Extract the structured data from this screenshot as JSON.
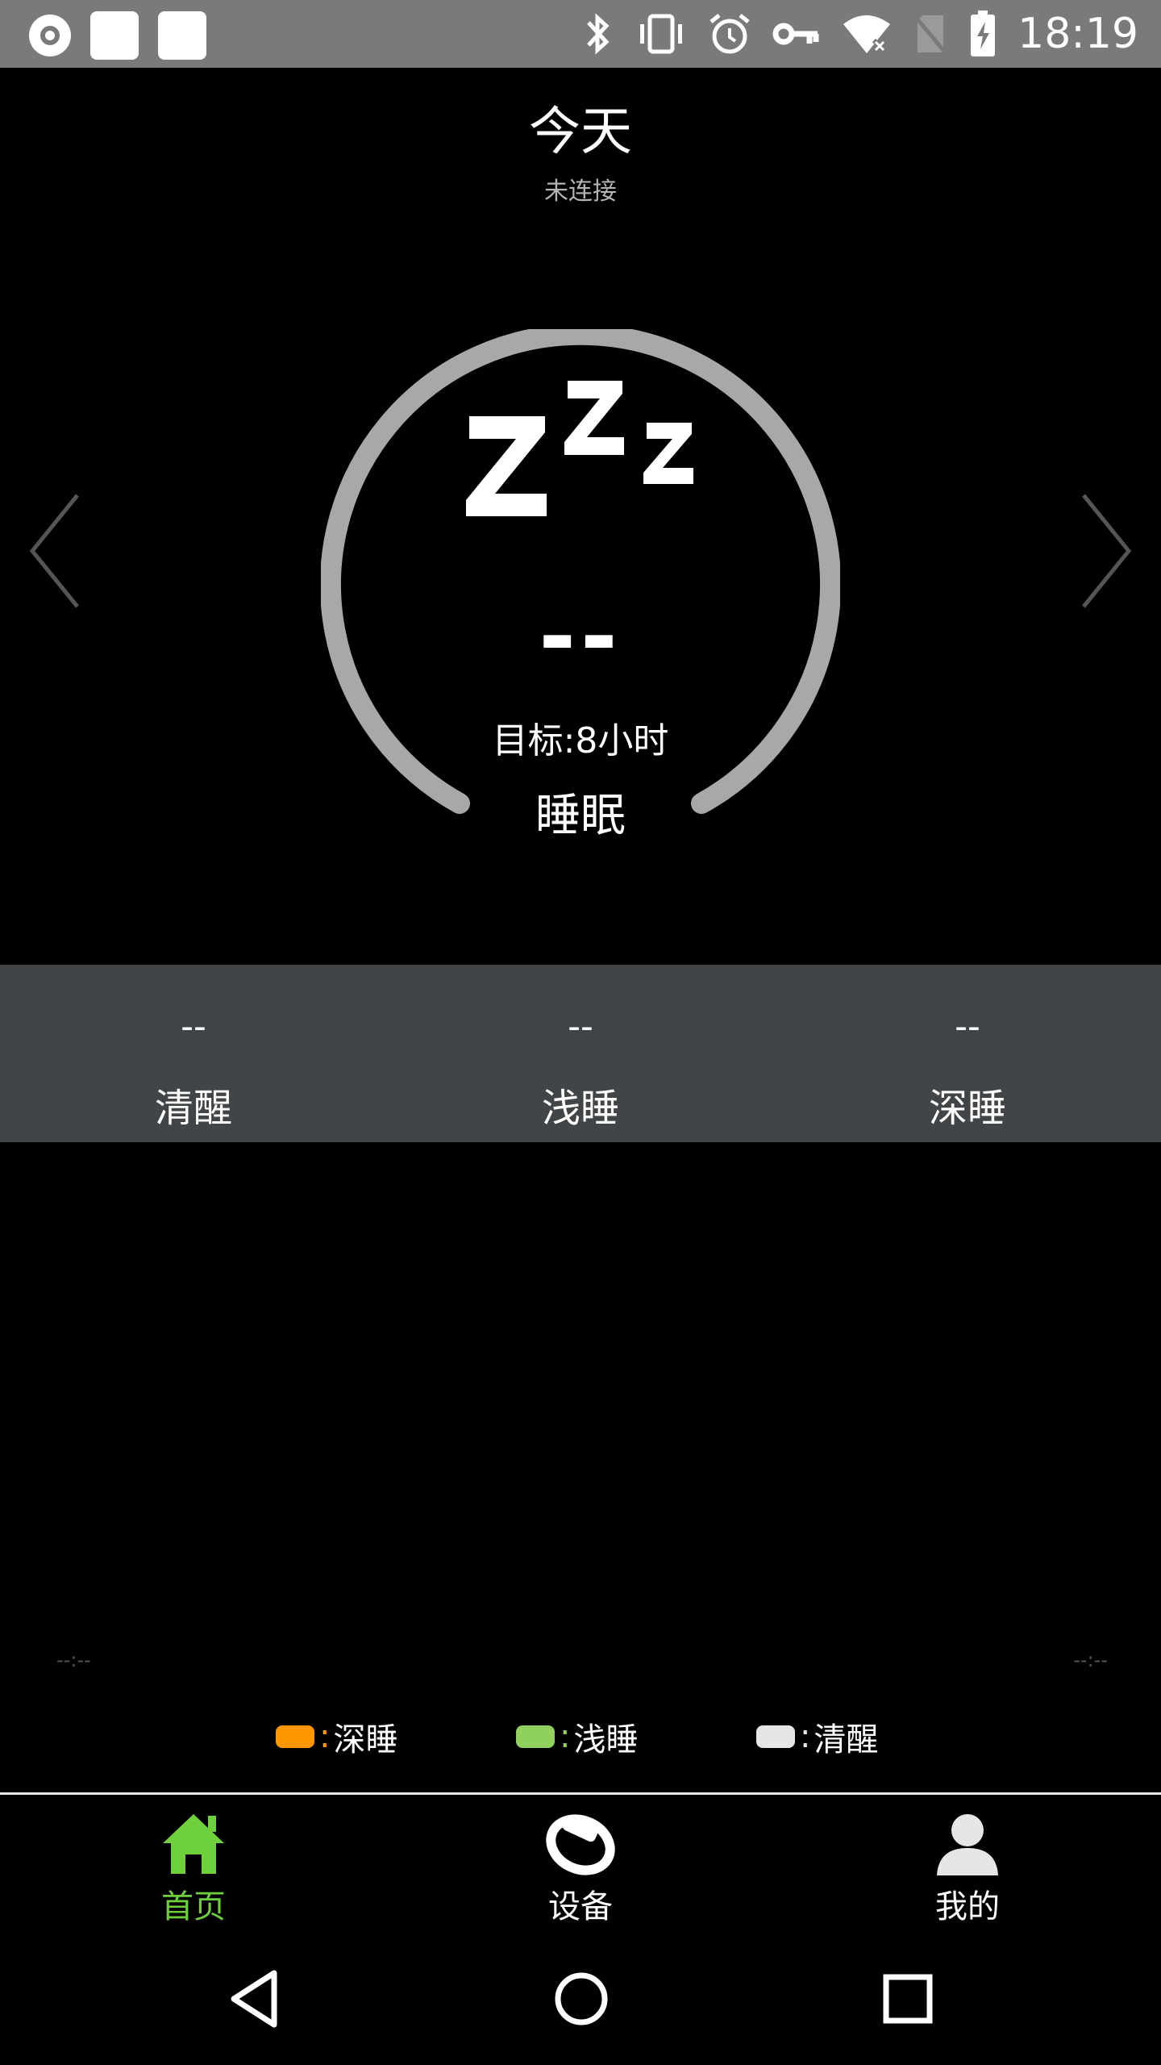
{
  "status_bar": {
    "time": "18:19",
    "icons": [
      "record-icon",
      "app-square-icon",
      "app-square-icon",
      "bluetooth-icon",
      "vibrate-icon",
      "alarm-icon",
      "vpn-key-icon",
      "wifi-off-icon",
      "no-sim-icon",
      "battery-charging-icon"
    ]
  },
  "header": {
    "title": "今天",
    "connection_status": "未连接"
  },
  "ring": {
    "icon": "sleep-zzz-icon",
    "value": "--",
    "goal": "目标:8小时",
    "label": "睡眠",
    "color": "#a8a8a8"
  },
  "stats": [
    {
      "value": "--",
      "label": "清醒"
    },
    {
      "value": "--",
      "label": "浅睡"
    },
    {
      "value": "--",
      "label": "深睡"
    }
  ],
  "chart_axis": {
    "start": "--:--",
    "end": "--:--"
  },
  "legend": [
    {
      "label": "深睡",
      "color": "#ff9800"
    },
    {
      "label": "浅睡",
      "color": "#8fd15c"
    },
    {
      "label": "清醒",
      "color": "#e6e6e6"
    }
  ],
  "bottom_nav": {
    "active_color": "#6fd03e",
    "items": [
      {
        "label": "首页",
        "icon": "home-icon",
        "active": true
      },
      {
        "label": "设备",
        "icon": "band-icon",
        "active": false
      },
      {
        "label": "我的",
        "icon": "person-icon",
        "active": false
      }
    ]
  },
  "system_nav": [
    "back-icon",
    "home-circle-icon",
    "recents-icon"
  ]
}
